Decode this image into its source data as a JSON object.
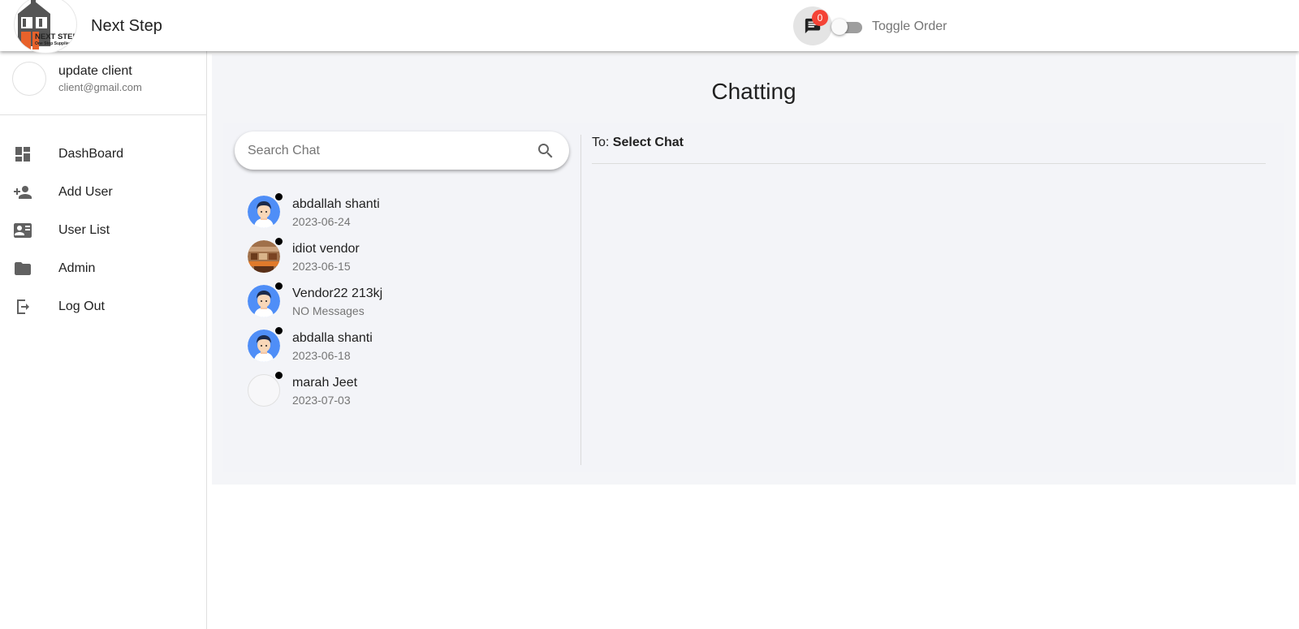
{
  "header": {
    "brand": "Next Step",
    "logo_text": "NEXT STEP",
    "logo_tagline": "One Stop Supplier",
    "notification_count": "0",
    "toggle_label": "Toggle Order"
  },
  "sidebar": {
    "profile": {
      "name": "update client",
      "email": "client@gmail.com"
    },
    "items": [
      {
        "label": "DashBoard",
        "icon": "dashboard-icon"
      },
      {
        "label": "Add User",
        "icon": "person-add-icon"
      },
      {
        "label": "User List",
        "icon": "contact-card-icon"
      },
      {
        "label": "Admin",
        "icon": "folder-icon"
      },
      {
        "label": "Log Out",
        "icon": "logout-icon"
      }
    ]
  },
  "main": {
    "title": "Chatting",
    "search": {
      "placeholder": "Search Chat",
      "value": ""
    },
    "to_prefix": "To:",
    "to_value": "Select Chat",
    "contacts": [
      {
        "name": "abdallah shanti",
        "sub": "2023-06-24",
        "avatar": "cartoon-man"
      },
      {
        "name": "idiot vendor",
        "sub": "2023-06-15",
        "avatar": "shop-photo"
      },
      {
        "name": "Vendor22 213kj",
        "sub": "NO Messages",
        "avatar": "cartoon-man"
      },
      {
        "name": "abdalla shanti",
        "sub": "2023-06-18",
        "avatar": "cartoon-man"
      },
      {
        "name": "marah Jeet",
        "sub": "2023-07-03",
        "avatar": "empty"
      }
    ]
  },
  "colors": {
    "badge": "#f44336",
    "avatar_blue": "#4f8ef7",
    "main_bg": "#f4f5f8",
    "logo_orange": "#e8622b"
  }
}
